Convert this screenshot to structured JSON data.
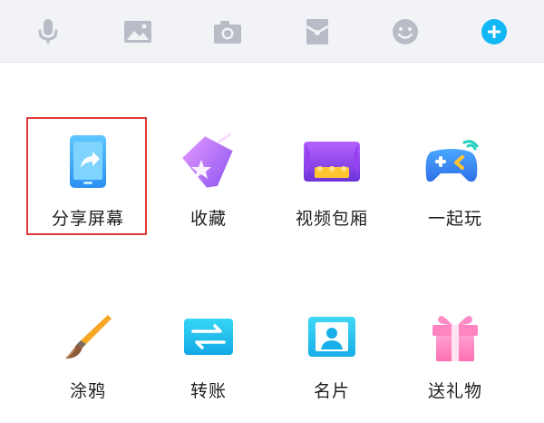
{
  "toolbar": {
    "buttons": [
      {
        "icon": "microphone-icon"
      },
      {
        "icon": "image-icon"
      },
      {
        "icon": "camera-icon"
      },
      {
        "icon": "red-packet-icon"
      },
      {
        "icon": "emoji-icon"
      },
      {
        "icon": "plus-icon"
      }
    ]
  },
  "panel": {
    "items": [
      {
        "label": "分享屏幕",
        "icon": "share-screen-icon"
      },
      {
        "label": "收藏",
        "icon": "favorites-icon"
      },
      {
        "label": "视频包厢",
        "icon": "video-box-icon"
      },
      {
        "label": "一起玩",
        "icon": "gamepad-icon"
      },
      {
        "label": "涂鸦",
        "icon": "paintbrush-icon"
      },
      {
        "label": "转账",
        "icon": "transfer-icon"
      },
      {
        "label": "名片",
        "icon": "contact-card-icon"
      },
      {
        "label": "送礼物",
        "icon": "gift-icon"
      }
    ]
  },
  "colors": {
    "toolbar_bg": "#f2f3f6",
    "toolbar_icon": "#b8bcc6",
    "accent_blue": "#12b7f5",
    "highlight_red": "#e03a3a"
  }
}
